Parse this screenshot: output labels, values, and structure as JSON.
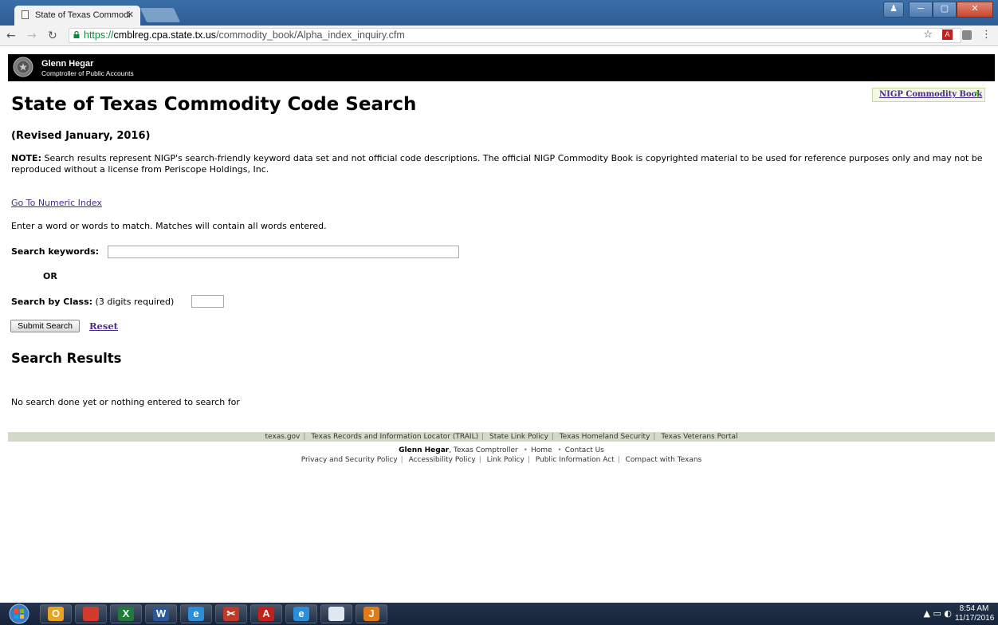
{
  "browser": {
    "tab_title": "State of Texas Commodi",
    "url_secure": "https://",
    "url_host": "cmblreg.cpa.state.tx.us",
    "url_path": "/commodity_book/Alpha_index_inquiry.cfm"
  },
  "agency": {
    "name": "Glenn Hegar",
    "title": "Comptroller of Public Accounts"
  },
  "nigp_link": "NIGP Commodity Book",
  "page": {
    "title": "State of Texas Commodity Code Search",
    "revised": "(Revised January, 2016)",
    "note_label": "NOTE:",
    "note_text": " Search results represent NIGP's search-friendly keyword data set and not official code descriptions. The official NIGP Commodity Book is copyrighted material to be used for reference purposes only and may not be reproduced without a license from Periscope Holdings, Inc.",
    "numeric_link": "Go To Numeric Index",
    "instructions": "Enter a word or words to match. Matches will contain all words entered."
  },
  "form": {
    "keywords_label": "Search keywords:",
    "keywords_value": "",
    "or_label": "OR",
    "class_label": "Search by Class:",
    "class_hint": " (3 digits required)",
    "class_value": "",
    "submit_label": "Submit Search",
    "reset_label": "Reset"
  },
  "results": {
    "heading": "Search Results",
    "message": "No search done yet or nothing entered to search for"
  },
  "footer": {
    "links": [
      "texas.gov",
      "Texas Records and Information Locator (TRAIL)",
      "State Link Policy",
      "Texas Homeland Security",
      "Texas Veterans Portal"
    ],
    "name": "Glenn Hegar",
    "role": ", Texas Comptroller",
    "home": "Home",
    "contact": "Contact Us",
    "policies": [
      "Privacy and Security Policy",
      "Accessibility Policy",
      "Link Policy",
      "Public Information Act",
      "Compact with Texans"
    ]
  },
  "taskbar": {
    "time": "8:54 AM",
    "date": "11/17/2016",
    "apps": [
      {
        "name": "outlook-icon",
        "glyph": "O",
        "color": "#e8a320"
      },
      {
        "name": "chrome-icon",
        "glyph": "",
        "color": "#d23b2c"
      },
      {
        "name": "excel-icon",
        "glyph": "X",
        "color": "#1f7a3c"
      },
      {
        "name": "word-icon",
        "glyph": "W",
        "color": "#2b5797"
      },
      {
        "name": "ie-icon",
        "glyph": "e",
        "color": "#2a8fd8"
      },
      {
        "name": "snipping-tool-icon",
        "glyph": "✂",
        "color": "#c0392b"
      },
      {
        "name": "acrobat-icon",
        "glyph": "A",
        "color": "#c3201b"
      },
      {
        "name": "ie-icon-2",
        "glyph": "e",
        "color": "#2a8fd8"
      },
      {
        "name": "notepad-icon",
        "glyph": "",
        "color": "#dfe8f0"
      },
      {
        "name": "java-icon",
        "glyph": "J",
        "color": "#e07b1a"
      }
    ]
  }
}
